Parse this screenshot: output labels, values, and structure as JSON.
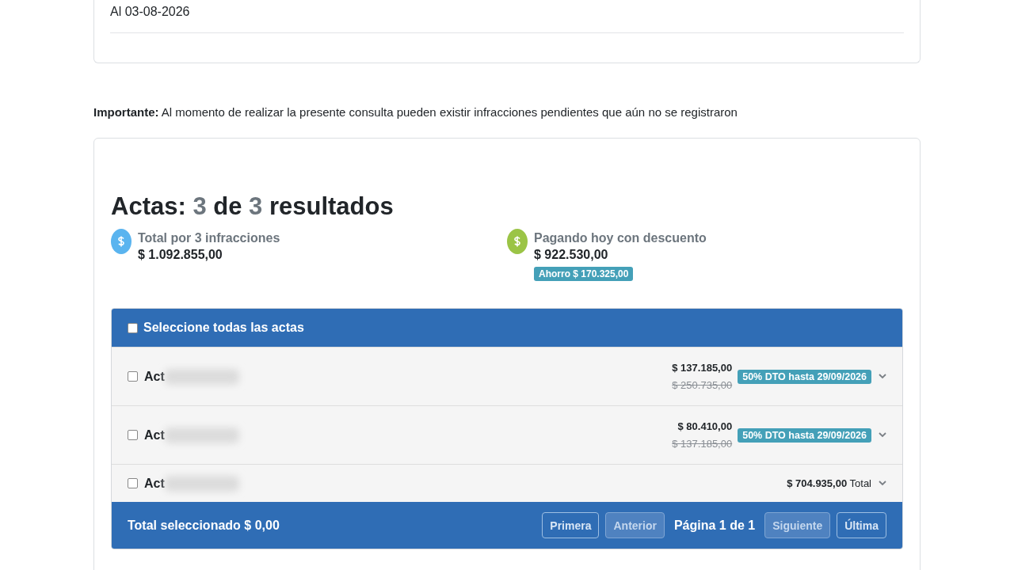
{
  "date_card": {
    "text": "Al 03-08-2026"
  },
  "notice": "**Importante:** Al momento de realizar la presente consulta pueden existir infracciones pendientes que aún no se registraron",
  "results": {
    "title": "Actas:",
    "shown": "3",
    "of": "de",
    "total": "3",
    "suffix": "resultados",
    "summary": [
      {
        "label": "Total por 3 infracciones",
        "amount": "$ 1.092.855,00",
        "color": "#5ab4ef"
      },
      {
        "label": "Pagando hoy con descuento",
        "amount": "$ 922.530,00",
        "color": "#9bc446",
        "badge": "Ahorro $ 170.325,00"
      }
    ],
    "select_all": {
      "label": "Seleccione todas las actas",
      "checked": false
    },
    "rows": [
      {
        "kind": "discount",
        "label": "Act",
        "checked": false,
        "amount": "$ 137.185,00",
        "original": "$ 250.735,00",
        "badge": "50% DTO hasta 29/09/2026"
      },
      {
        "kind": "discount",
        "label": "Act",
        "checked": false,
        "amount": "$ 80.410,00",
        "original": "$ 137.185,00",
        "badge": "50% DTO hasta 29/09/2026"
      },
      {
        "kind": "total",
        "label": "Act",
        "checked": false,
        "amount": "**$ 704.935,00** Total"
      }
    ],
    "footer": {
      "total": "Total seleccionado $ 0,00",
      "page": "Página 1 de 1",
      "buttons": [
        {
          "label": "Primera",
          "disabled": false
        },
        {
          "label": "Anterior",
          "disabled": true
        }
      ],
      "buttons_after": [
        {
          "label": "Siguiente",
          "disabled": true
        },
        {
          "label": "Última",
          "disabled": false
        }
      ]
    }
  }
}
